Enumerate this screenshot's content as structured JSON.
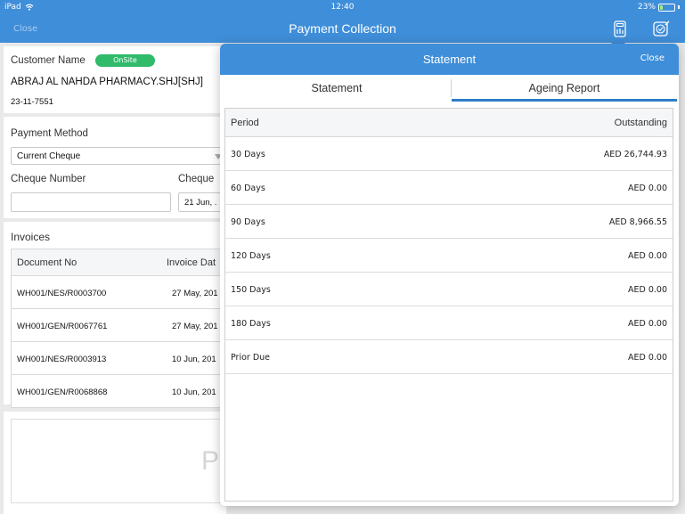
{
  "status_bar": {
    "device": "iPad",
    "time": "12:40",
    "battery": "23%",
    "battery_level": 0.23
  },
  "navbar": {
    "close": "Close",
    "title": "Payment Collection"
  },
  "form": {
    "customer_name_label": "Customer Name",
    "onsite_badge": "OnSite",
    "customer_name": "ABRAJ AL NAHDA PHARMACY.SHJ[SHJ]",
    "customer_date": "23-11-7551",
    "payment_method_label": "Payment Method",
    "payment_method_value": "Current Cheque",
    "cheque_number_label": "Cheque Number",
    "cheque_date_label": "Cheque",
    "cheque_date_value": "21 Jun, .",
    "invoices_label": "Invoices",
    "invoice_headers": [
      "Document No",
      "Invoice Dat"
    ],
    "invoices": [
      {
        "doc": "WH001/NES/R0003700",
        "date": "27 May, 201"
      },
      {
        "doc": "WH001/GEN/R0067761",
        "date": "27 May, 201"
      },
      {
        "doc": "WH001/NES/R0003913",
        "date": "10 Jun, 201"
      },
      {
        "doc": "WH001/GEN/R0068868",
        "date": "10 Jun, 201"
      }
    ],
    "bottom_placeholder": "P"
  },
  "modal": {
    "title": "Statement",
    "close": "Close",
    "tabs": [
      {
        "label": "Statement",
        "active": false
      },
      {
        "label": "Ageing Report",
        "active": true
      }
    ],
    "table_headers": {
      "period": "Period",
      "outstanding": "Outstanding"
    },
    "rows": [
      {
        "period": "30 Days",
        "amount": "AED 26,744.93"
      },
      {
        "period": "60 Days",
        "amount": "AED 0.00"
      },
      {
        "period": "90 Days",
        "amount": "AED 8,966.55"
      },
      {
        "period": "120 Days",
        "amount": "AED 0.00"
      },
      {
        "period": "150 Days",
        "amount": "AED 0.00"
      },
      {
        "period": "180 Days",
        "amount": "AED 0.00"
      },
      {
        "period": "Prior Due",
        "amount": "AED 0.00"
      }
    ]
  },
  "colors": {
    "brand_blue": "#3f8ed9",
    "onsite_green": "#2fbb6a",
    "tab_underline": "#2e7dc7"
  }
}
